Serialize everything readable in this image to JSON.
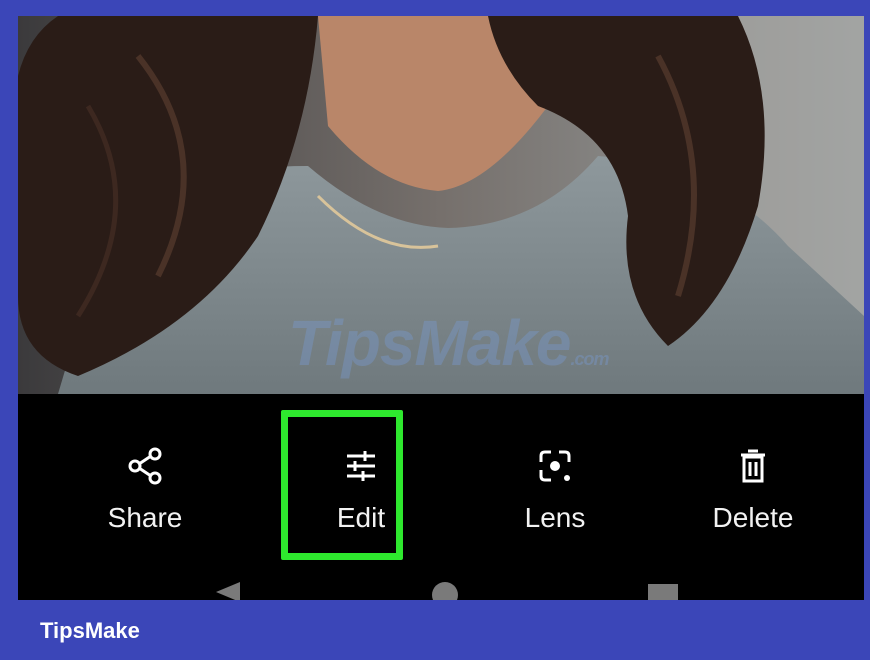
{
  "watermark": {
    "brand_main": "TipsMake",
    "brand_suffix": ".com"
  },
  "actions": [
    {
      "label": "Share",
      "icon": "share-icon"
    },
    {
      "label": "Edit",
      "icon": "sliders-icon"
    },
    {
      "label": "Lens",
      "icon": "lens-icon"
    },
    {
      "label": "Delete",
      "icon": "trash-icon"
    }
  ],
  "highlight_color": "#2ee82e",
  "footer": {
    "brand": "TipsMake"
  },
  "colors": {
    "frame": "#3b46b8",
    "toolbar": "#000000",
    "nav": "#7a7a7a"
  },
  "nav": [
    "back-icon",
    "home-icon",
    "recents-icon"
  ]
}
